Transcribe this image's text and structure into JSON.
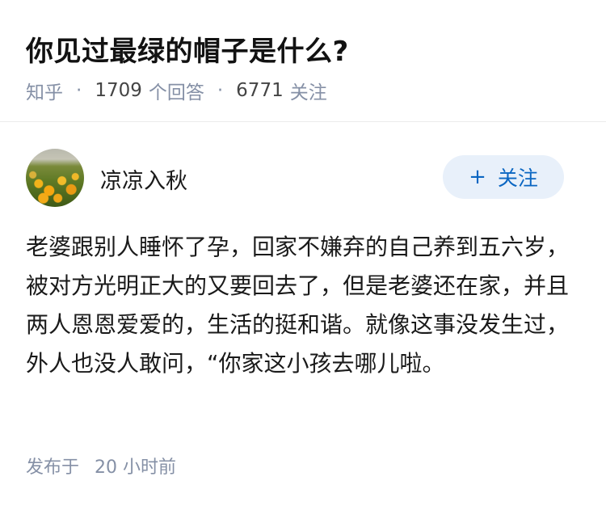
{
  "question": {
    "title": "你见过最绿的帽子是什么?",
    "source": "知乎",
    "answer_count": "1709",
    "answer_label": "个回答",
    "follow_count": "6771",
    "follow_label": "关注"
  },
  "author": {
    "name": "凉凉入秋",
    "follow_button": "关注",
    "follow_icon": "plus-icon"
  },
  "answer": {
    "text": "老婆跟别人睡怀了孕，回家不嫌弃的自己养到五六岁，被对方光明正大的又要回去了，但是老婆还在家，并且两人恩恩爱爱的，生活的挺和谐。就像这事没发生过，外人也没人敢问，“你家这小孩去哪儿啦。"
  },
  "footer": {
    "published_label": "发布于",
    "time": "20 小时前"
  },
  "colors": {
    "accent": "#0a66c2",
    "button_bg": "#e8f0fa",
    "meta": "#8590a6"
  }
}
